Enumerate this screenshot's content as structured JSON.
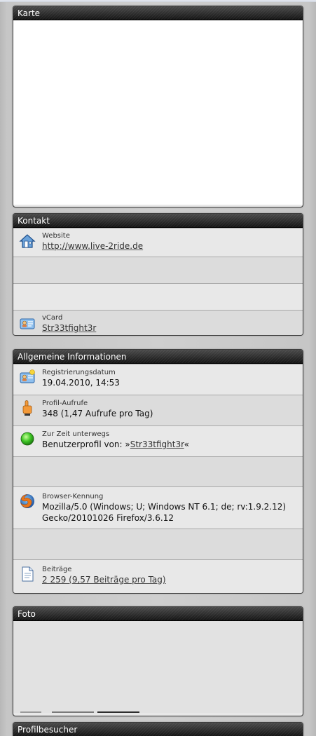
{
  "sections": {
    "karte": {
      "title": "Karte"
    },
    "kontakt": {
      "title": "Kontakt",
      "website_label": "Website",
      "website_value": "http://www.live-2ride.de",
      "vcard_label": "vCard",
      "vcard_value": "Str33tfight3r"
    },
    "allgemein": {
      "title": "Allgemeine Informationen",
      "reg_label": "Registrierungsdatum",
      "reg_value": "19.04.2010, 14:53",
      "views_label": "Profil-Aufrufe",
      "views_value": "348 (1,47 Aufrufe pro Tag)",
      "online_label": "Zur Zeit unterwegs",
      "online_prefix": "Benutzerprofil von: »",
      "online_user": "Str33tfight3r",
      "online_suffix": "«",
      "browser_label": "Browser-Kennung",
      "browser_line1": "Mozilla/5.0 (Windows; U; Windows NT 6.1; de; rv:1.9.2.12)",
      "browser_line2": "Gecko/20101026 Firefox/3.6.12",
      "posts_label": "Beiträge",
      "posts_value": "2 259 (9,57 Beiträge pro Tag)"
    },
    "foto": {
      "title": "Foto"
    },
    "besucher": {
      "title": "Profilbesucher"
    }
  },
  "icons": {
    "website": "home-icon",
    "vcard": "vcard-icon",
    "registration": "id-card-icon",
    "views": "pointing-hand-icon",
    "online": "green-status-icon",
    "browser": "firefox-icon",
    "posts": "document-icon"
  }
}
